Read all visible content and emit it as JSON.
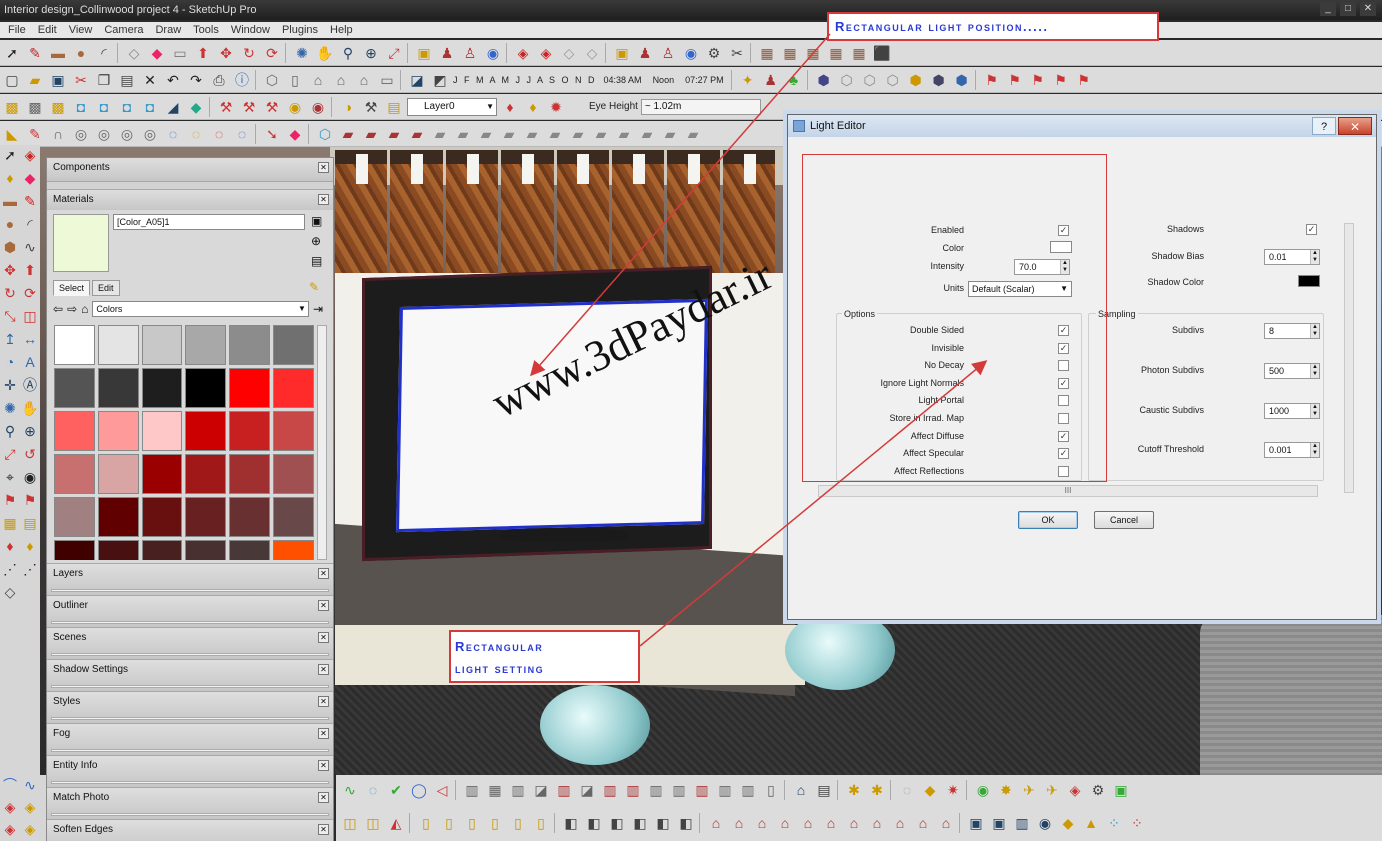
{
  "window": {
    "title": "Interior design_Collinwood project 4 - SketchUp Pro",
    "controls": [
      "_",
      "□",
      "✕"
    ]
  },
  "menu": [
    "File",
    "Edit",
    "View",
    "Camera",
    "Draw",
    "Tools",
    "Window",
    "Plugins",
    "Help"
  ],
  "toolbar": {
    "layer_value": "Layer0",
    "shadow_months": "J F M A M J J A S O N D",
    "time_start": "04:38 AM",
    "time_noon": "Noon",
    "time_end": "07:27 PM",
    "eye_height_label": "Eye Height",
    "eye_height_value": "~ 1.02m"
  },
  "tray": {
    "components_title": "Components",
    "materials_title": "Materials",
    "material_name": "[Color_A05]1",
    "tab_select": "Select",
    "tab_edit": "Edit",
    "library_value": "Colors",
    "swatch_color": "#eef9d8",
    "colors": [
      "#ffffff",
      "#e4e4e4",
      "#c8c8c8",
      "#a8a8a8",
      "#8c8c8c",
      "#707070",
      "#545454",
      "#383838",
      "#1e1e1e",
      "#000000",
      "#ff0000",
      "#ff2a2a",
      "#ff6060",
      "#ff9a9a",
      "#ffc8c8",
      "#cc0000",
      "#c82020",
      "#c84848",
      "#c87070",
      "#d8a4a4",
      "#9a0000",
      "#a01818",
      "#a03030",
      "#a05050",
      "#a08080",
      "#600000",
      "#681010",
      "#682020",
      "#683030",
      "#684848",
      "#400000",
      "#481010",
      "#482020",
      "#483030",
      "#483838",
      "#ff5000"
    ],
    "panels": [
      "Layers",
      "Outliner",
      "Scenes",
      "Shadow Settings",
      "Styles",
      "Fog",
      "Entity Info",
      "Match Photo",
      "Soften Edges"
    ]
  },
  "dialog": {
    "title": "Light Editor",
    "help": "?",
    "close": "✕",
    "enabled_label": "Enabled",
    "color_label": "Color",
    "intensity_label": "Intensity",
    "intensity_value": "70.0",
    "units_label": "Units",
    "units_value": "Default (Scalar)",
    "shadows_label": "Shadows",
    "shadow_bias_label": "Shadow Bias",
    "shadow_bias_value": "0.01",
    "shadow_color_label": "Shadow Color",
    "options_title": "Options",
    "options": [
      {
        "label": "Double Sided",
        "checked": true
      },
      {
        "label": "Invisible",
        "checked": true
      },
      {
        "label": "No Decay",
        "checked": false
      },
      {
        "label": "Ignore Light Normals",
        "checked": true
      },
      {
        "label": "Light Portal",
        "checked": false
      },
      {
        "label": "Store in Irrad. Map",
        "checked": false
      },
      {
        "label": "Affect Diffuse",
        "checked": true
      },
      {
        "label": "Affect Specular",
        "checked": true
      },
      {
        "label": "Affect Reflections",
        "checked": false
      }
    ],
    "sampling_title": "Sampling",
    "subdivs_label": "Subdivs",
    "subdivs_value": "8",
    "photon_subdivs_label": "Photon Subdivs",
    "photon_subdivs_value": "500",
    "caustic_subdivs_label": "Caustic Subdivs",
    "caustic_subdivs_value": "1000",
    "cutoff_label": "Cutoff Threshold",
    "cutoff_value": "0.001",
    "hscroll_grip": "III",
    "ok_label": "OK",
    "cancel_label": "Cancel",
    "light_color": "#ffffff",
    "shadow_color": "#000000"
  },
  "annotations": {
    "position_callout": "Rectangular light position.....",
    "setting_callout_line1": "Rectangular",
    "setting_callout_line2": "light setting",
    "watermark": "www.3dPaydar.ir",
    "accent": "#d43a3a",
    "text_color": "#2a3ad4"
  }
}
